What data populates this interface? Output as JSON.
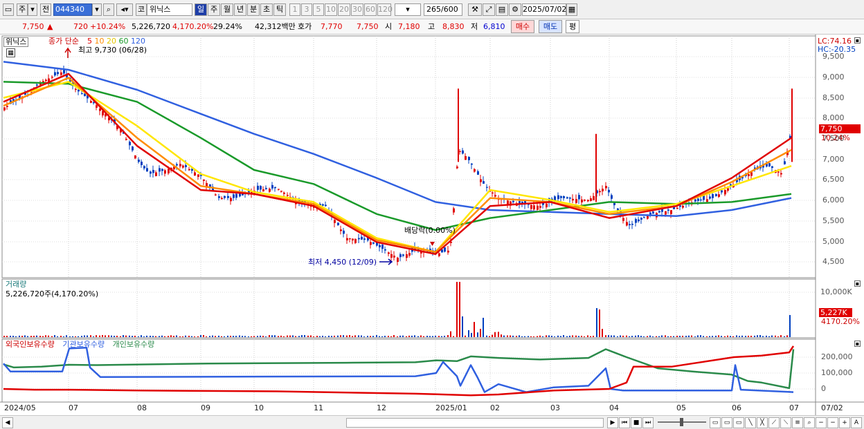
{
  "toolbar": {
    "market_label": "주",
    "prev_label": "전",
    "code": "044340",
    "market_type": "코",
    "stock_name": "위닉스",
    "period_buttons": [
      "일",
      "주",
      "월",
      "년",
      "분",
      "초",
      "틱"
    ],
    "minute_buttons": [
      "1",
      "3",
      "5",
      "10",
      "20",
      "30",
      "60",
      "120"
    ],
    "count": "265",
    "count_total": "/600",
    "date": "2025/07/02"
  },
  "quote": {
    "price": "7,750",
    "change": "720",
    "change_pct": "+10.24%",
    "volume": "5,226,720",
    "volume_pct": "4,170.20%",
    "turnover_pct": "29.24%",
    "amount": "42,312백만",
    "bid_label": "호가",
    "bid1": "7,770",
    "bid2": "7,750",
    "open_label": "시",
    "open": "7,180",
    "high_label": "고",
    "high": "8,830",
    "low_label": "저",
    "low": "6,810",
    "buy_label": "매수",
    "sell_label": "매도",
    "eval_label": "평"
  },
  "price_panel": {
    "name": "위닉스",
    "ma_title": "종가 단순",
    "ma_periods": [
      "5",
      "10",
      "20",
      "60",
      "120"
    ],
    "high_note": "최고 9,730 (06/28)",
    "low_note": "최저 4,450 (12/09)",
    "dividend_note": "배당락(0.00%)",
    "lc": "LC:74.16",
    "hc": "HC:-20.35",
    "last_tag": "7,750",
    "last_pct_tag": "10.24%",
    "y_ticks": [
      "9,500",
      "9,000",
      "8,500",
      "8,000",
      "7,500",
      "7,000",
      "6,500",
      "6,000",
      "5,500",
      "5,000",
      "4,500"
    ]
  },
  "volume_panel": {
    "title": "거래량",
    "value": "5,226,720주(4,170.20%)",
    "y_tick": "10,000K",
    "tag1": "5,227K",
    "tag2": "4170.20%"
  },
  "holding_panel": {
    "legend": [
      "외국인보유수량",
      "기관보유수량",
      "개인보유수량"
    ],
    "y_ticks": [
      "200,000",
      "100,000",
      "0"
    ]
  },
  "x_axis": {
    "labels": [
      "2024/05",
      "07",
      "08",
      "09",
      "10",
      "11",
      "12",
      "2025/01",
      "02",
      "03",
      "04",
      "05",
      "06",
      "07",
      "07/02"
    ]
  },
  "colors": {
    "ma5": "#e00000",
    "ma10": "#ff8c00",
    "ma20": "#ffe600",
    "ma60": "#1a9a2a",
    "ma120": "#3060e0",
    "up": "#e00000",
    "down": "#0040c0",
    "foreign": "#e00000",
    "inst": "#3060e0",
    "retail": "#2a8a4a"
  },
  "chart_data": [
    {
      "type": "line",
      "title": "위닉스",
      "x": [
        "2024/05",
        "2024/07",
        "2024/08",
        "2024/09",
        "2024/10",
        "2024/11",
        "2024/12",
        "2025/01",
        "2025/02",
        "2025/03",
        "2025/04",
        "2025/05",
        "2025/06",
        "2025/07"
      ],
      "series": [
        {
          "name": "5",
          "values": [
            8500,
            9200,
            7400,
            6300,
            6200,
            5900,
            5000,
            4700,
            5900,
            6000,
            5600,
            5900,
            6600,
            7600
          ]
        },
        {
          "name": "10",
          "values": [
            8400,
            9100,
            7600,
            6400,
            6200,
            5950,
            5050,
            4750,
            6100,
            6000,
            5700,
            5900,
            6500,
            7300
          ]
        },
        {
          "name": "20",
          "values": [
            8600,
            9000,
            7900,
            6700,
            6250,
            6000,
            5100,
            4750,
            6300,
            6050,
            5750,
            5950,
            6400,
            6900
          ]
        },
        {
          "name": "60",
          "values": [
            9000,
            8950,
            8500,
            7600,
            6800,
            6450,
            5700,
            5300,
            5600,
            5800,
            6000,
            5950,
            6000,
            6200
          ]
        },
        {
          "name": "120",
          "values": [
            9500,
            9300,
            8800,
            8200,
            7700,
            7200,
            6600,
            6000,
            5800,
            5750,
            5700,
            5650,
            5800,
            6100
          ]
        }
      ],
      "ylim": [
        4300,
        9800
      ]
    }
  ]
}
